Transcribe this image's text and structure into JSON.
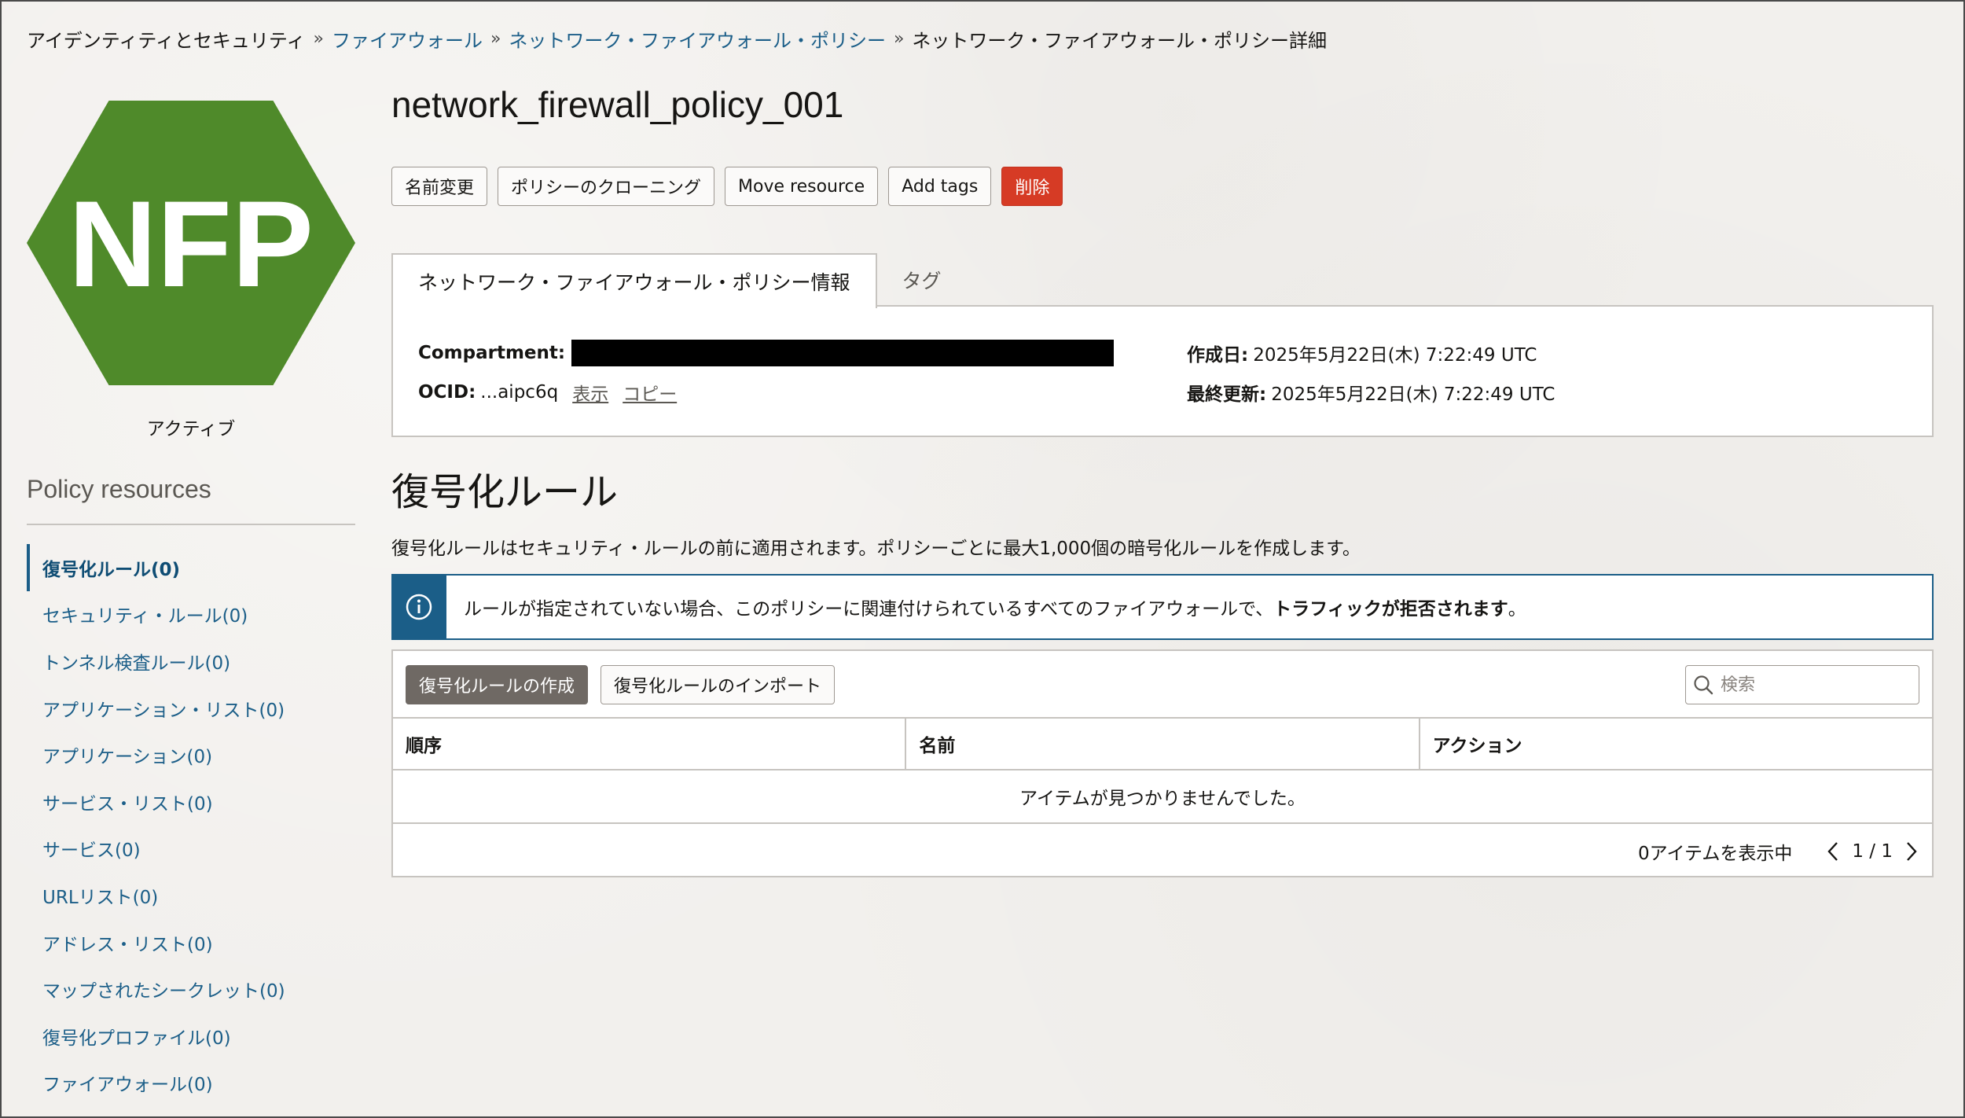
{
  "breadcrumb": {
    "items": [
      {
        "label": "アイデンティティとセキュリティ",
        "link": false
      },
      {
        "label": "ファイアウォール",
        "link": true
      },
      {
        "label": "ネットワーク・ファイアウォール・ポリシー",
        "link": true
      },
      {
        "label": "ネットワーク・ファイアウォール・ポリシー詳細",
        "link": false
      }
    ],
    "separator": "»"
  },
  "resource_icon": {
    "text": "NFP",
    "color": "#4f8a2a",
    "shape": "hexagon"
  },
  "status": "アクティブ",
  "sidebar": {
    "title": "Policy resources",
    "items": [
      {
        "label": "復号化ルール(0)",
        "active": true
      },
      {
        "label": "セキュリティ・ルール(0)",
        "active": false
      },
      {
        "label": "トンネル検査ルール(0)",
        "active": false
      },
      {
        "label": "アプリケーション・リスト(0)",
        "active": false
      },
      {
        "label": "アプリケーション(0)",
        "active": false
      },
      {
        "label": "サービス・リスト(0)",
        "active": false
      },
      {
        "label": "サービス(0)",
        "active": false
      },
      {
        "label": "URLリスト(0)",
        "active": false
      },
      {
        "label": "アドレス・リスト(0)",
        "active": false
      },
      {
        "label": "マップされたシークレット(0)",
        "active": false
      },
      {
        "label": "復号化プロファイル(0)",
        "active": false
      },
      {
        "label": "ファイアウォール(0)",
        "active": false
      }
    ]
  },
  "header": {
    "title": "network_firewall_policy_001"
  },
  "actions": {
    "rename": "名前変更",
    "clone": "ポリシーのクローニング",
    "move": "Move resource",
    "add_tags": "Add tags",
    "delete": "削除"
  },
  "tabs": [
    {
      "label": "ネットワーク・ファイアウォール・ポリシー情報",
      "active": true
    },
    {
      "label": "タグ",
      "active": false
    }
  ],
  "info": {
    "compartment_label": "Compartment:",
    "ocid_label": "OCID:",
    "ocid_value": "...aipc6q",
    "show_link": "表示",
    "copy_link": "コピー",
    "created_label": "作成日:",
    "created_value": "2025年5月22日(木) 7:22:49 UTC",
    "updated_label": "最終更新:",
    "updated_value": "2025年5月22日(木) 7:22:49 UTC"
  },
  "section": {
    "title": "復号化ルール",
    "description": "復号化ルールはセキュリティ・ルールの前に適用されます。ポリシーごとに最大1,000個の暗号化ルールを作成します。"
  },
  "alert": {
    "text": "ルールが指定されていない場合、このポリシーに関連付けられているすべてのファイアウォールで、",
    "bold_text": "トラフィックが拒否されます",
    "suffix": "。",
    "icon": "info-icon"
  },
  "table": {
    "create_button": "復号化ルールの作成",
    "import_button": "復号化ルールのインポート",
    "search_placeholder": "検索",
    "columns": [
      "順序",
      "名前",
      "アクション"
    ],
    "empty_message": "アイテムが見つかりませんでした。",
    "footer_count": "0アイテムを表示中",
    "page": "1 / 1"
  },
  "colors": {
    "link": "#1b5e88",
    "danger": "#d63b25",
    "brand_green": "#4f8a2a",
    "primary_button": "#6f6964"
  }
}
